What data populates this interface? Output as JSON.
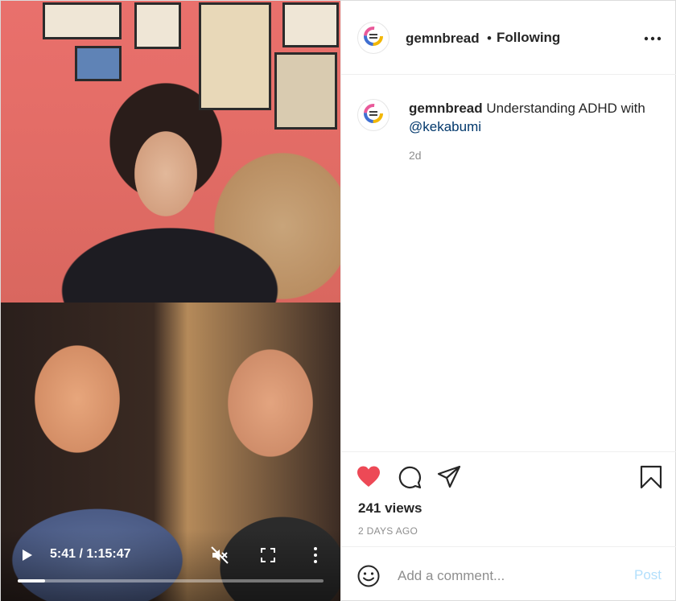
{
  "post": {
    "author": "gemnbread",
    "separator": "•",
    "follow_status": "Following",
    "caption_text": " Understanding ADHD with ",
    "mention": "@kekabumi",
    "age": "2d",
    "views": "241 views",
    "posted": "2 DAYS AGO"
  },
  "video": {
    "time": "5:41 / 1:15:47",
    "progress": 0.09
  },
  "comment": {
    "placeholder": "Add a comment...",
    "post_label": "Post"
  },
  "colors": {
    "like": "#ed4956",
    "mention": "#00376b",
    "post_disabled": "#b2dffc"
  },
  "icons": [
    "play-icon",
    "mute-icon",
    "fullscreen-icon",
    "more-vertical-icon",
    "more-horizontal-icon",
    "heart-icon",
    "comment-icon",
    "share-icon",
    "bookmark-icon",
    "emoji-icon"
  ]
}
